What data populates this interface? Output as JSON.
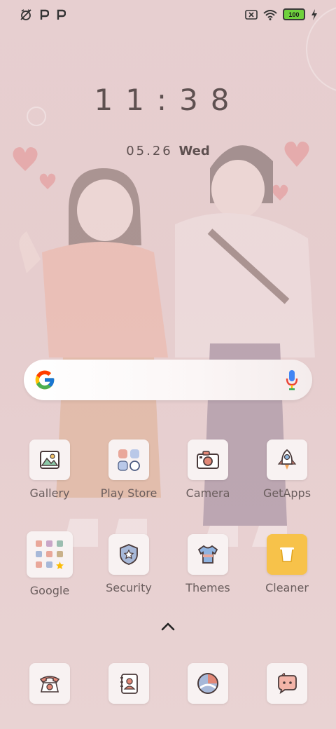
{
  "status_bar": {
    "left_icons": [
      "alarm-off-icon",
      "p-notification-icon",
      "p-notification-icon"
    ],
    "right_icons": [
      "no-sim-icon",
      "wifi-icon",
      "battery-icon",
      "charging-icon"
    ],
    "battery_level": "100"
  },
  "lockscreen": {
    "time": "11:38",
    "date": "05.26",
    "weekday": "Wed"
  },
  "search": {
    "google_icon": "google-icon",
    "mic_icon": "mic-icon"
  },
  "apps": [
    {
      "label": "Gallery",
      "icon": "gallery-icon"
    },
    {
      "label": "Play Store",
      "icon": "play-store-icon"
    },
    {
      "label": "Camera",
      "icon": "camera-icon"
    },
    {
      "label": "GetApps",
      "icon": "rocket-icon"
    },
    {
      "label": "Google",
      "icon": "google-folder-icon"
    },
    {
      "label": "Security",
      "icon": "shield-icon"
    },
    {
      "label": "Themes",
      "icon": "tshirt-icon"
    },
    {
      "label": "Cleaner",
      "icon": "trash-icon"
    }
  ],
  "drawer_icon": "chevron-up-icon",
  "dock": [
    {
      "icon": "phone-icon"
    },
    {
      "icon": "contacts-icon"
    },
    {
      "icon": "browser-icon"
    },
    {
      "icon": "messages-icon"
    }
  ],
  "colors": {
    "background": "#e7cfd0",
    "battery": "#6fd13d",
    "text": "#5e5050"
  }
}
